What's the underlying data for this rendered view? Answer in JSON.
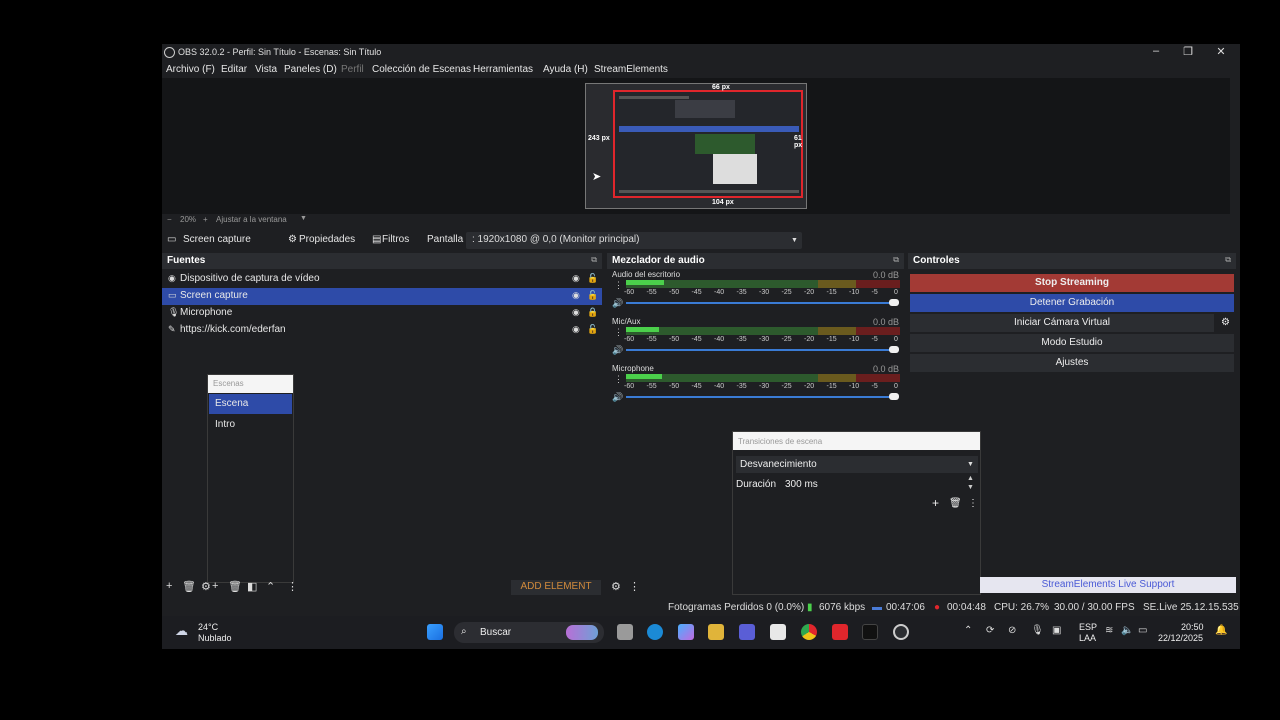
{
  "window": {
    "title": "OBS 32.0.2 - Perfil: Sin Título - Escenas: Sin Título",
    "minimize_glyph": "–",
    "maximize_glyph": "❐",
    "close_glyph": "✕"
  },
  "menu": [
    "Archivo (F)",
    "Editar",
    "Vista",
    "Paneles (D)",
    "Perfil",
    "Colección de Escenas",
    "Herramientas",
    "Ayuda (H)",
    "StreamElements"
  ],
  "preview": {
    "label_top": "66 px",
    "label_left": "243 px",
    "label_right": "61 px",
    "label_bottom": "104 px"
  },
  "zoom": {
    "minus": "−",
    "value": "20%",
    "plus": "+",
    "mode": "Ajustar a la ventana"
  },
  "source_bar": {
    "selected_source": "Screen capture",
    "properties": "Propiedades",
    "filters": "Filtros",
    "screen_label": "Pantalla",
    "screen_value": ": 1920x1080 @ 0,0 (Monitor principal)"
  },
  "sources": {
    "title": "Fuentes",
    "items": [
      {
        "label": "Dispositivo de captura de vídeo",
        "icon": "camera-icon",
        "glyph": "◉"
      },
      {
        "label": "Screen capture",
        "icon": "monitor-icon",
        "glyph": "▭"
      },
      {
        "label": "Microphone",
        "icon": "microphone-icon",
        "glyph": "🎙"
      },
      {
        "label": "https://kick.com/ederfan",
        "icon": "browser-icon",
        "glyph": "✎"
      }
    ],
    "selected_index": 1
  },
  "scenes": {
    "title": "Escenas",
    "items": [
      "Escena",
      "Intro"
    ],
    "selected_index": 0
  },
  "bottom_toolbar": {
    "add_element": "ADD ELEMENT"
  },
  "mixer": {
    "title": "Mezclador de audio",
    "scale": [
      "-60",
      "-55",
      "-50",
      "-45",
      "-40",
      "-35",
      "-30",
      "-25",
      "-20",
      "-15",
      "-10",
      "-5",
      "0"
    ],
    "tracks": [
      {
        "name": "Audio del escritorio",
        "db": "0.0 dB",
        "level": 0.14
      },
      {
        "name": "Mic/Aux",
        "db": "0.0 dB",
        "level": 0.12
      },
      {
        "name": "Microphone",
        "db": "0.0 dB",
        "level": 0.13
      }
    ]
  },
  "controls": {
    "title": "Controles",
    "stop_streaming": "Stop Streaming",
    "stop_recording": "Detener Grabación",
    "virtual_camera": "Iniciar Cámara Virtual",
    "studio_mode": "Modo Estudio",
    "settings": "Ajustes"
  },
  "transitions": {
    "title": "Transiciones de escena",
    "selected": "Desvanecimiento",
    "duration_label": "Duración",
    "duration_value": "300 ms"
  },
  "se_support": "StreamElements Live Support",
  "status": {
    "dropped_frames": "Fotogramas Perdidos 0 (0.0%)",
    "bitrate": "6076 kbps",
    "stream_time": "00:47:06",
    "rec_time": "00:04:48",
    "cpu": "CPU: 26.7%",
    "fps": "30.00 / 30.00 FPS",
    "se_version": "SE.Live 25.12.15.535"
  },
  "taskbar": {
    "temperature": "24°C",
    "weather": "Nublado",
    "search": "Buscar",
    "lang_top": "ESP",
    "lang_bottom": "LAA",
    "time": "20:50",
    "date": "22/12/2025"
  },
  "colors": {
    "stop_streaming_bg": "#a33a35",
    "stop_recording_bg": "#2e4ba8",
    "accent": "#2e4ba8",
    "live_support_text": "#4a5ad6"
  }
}
